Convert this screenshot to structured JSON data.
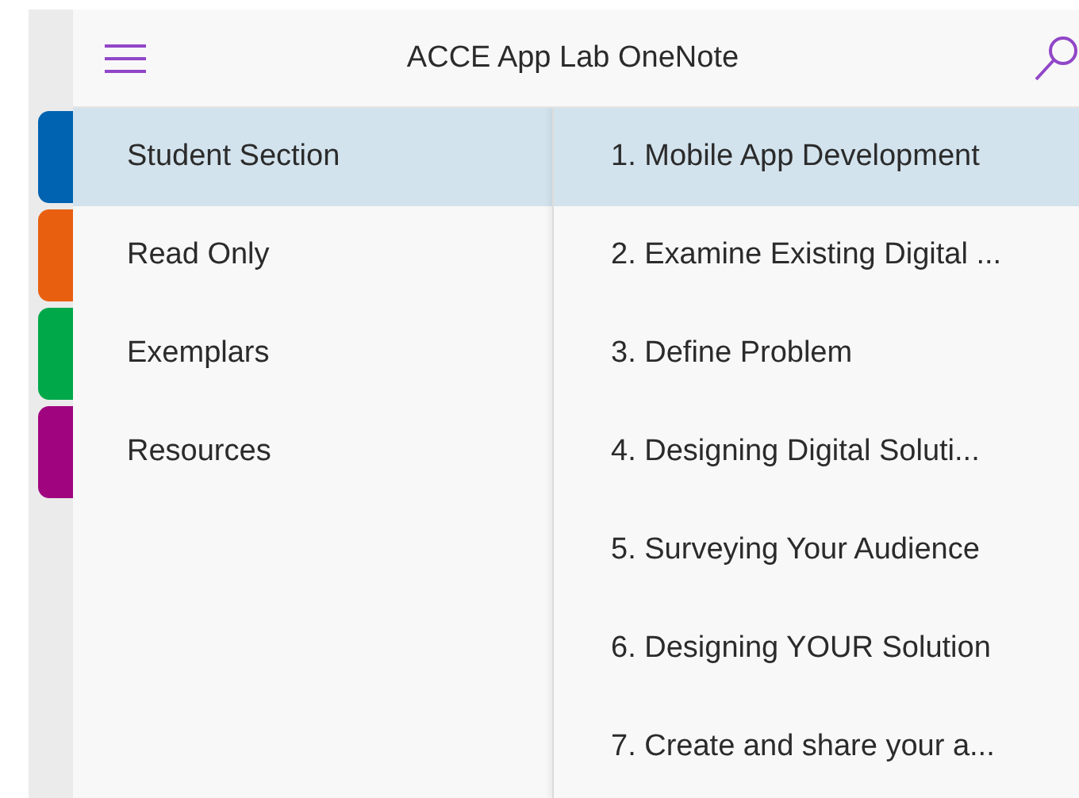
{
  "header": {
    "title": "ACCE App Lab OneNote"
  },
  "sections": [
    {
      "label": "Student Section",
      "color": "#0063b1",
      "selected": true
    },
    {
      "label": "Read Only",
      "color": "#e8600f",
      "selected": false
    },
    {
      "label": "Exemplars",
      "color": "#00a84a",
      "selected": false
    },
    {
      "label": "Resources",
      "color": "#a0047f",
      "selected": false
    }
  ],
  "pages": [
    {
      "label": "1. Mobile App Development",
      "selected": true
    },
    {
      "label": "2. Examine Existing Digital ...",
      "selected": false
    },
    {
      "label": "3. Define Problem",
      "selected": false
    },
    {
      "label": "4. Designing Digital Soluti...",
      "selected": false
    },
    {
      "label": "5. Surveying Your Audience",
      "selected": false
    },
    {
      "label": "6. Designing YOUR Solution",
      "selected": false
    },
    {
      "label": "7. Create and share your a...",
      "selected": false
    }
  ]
}
